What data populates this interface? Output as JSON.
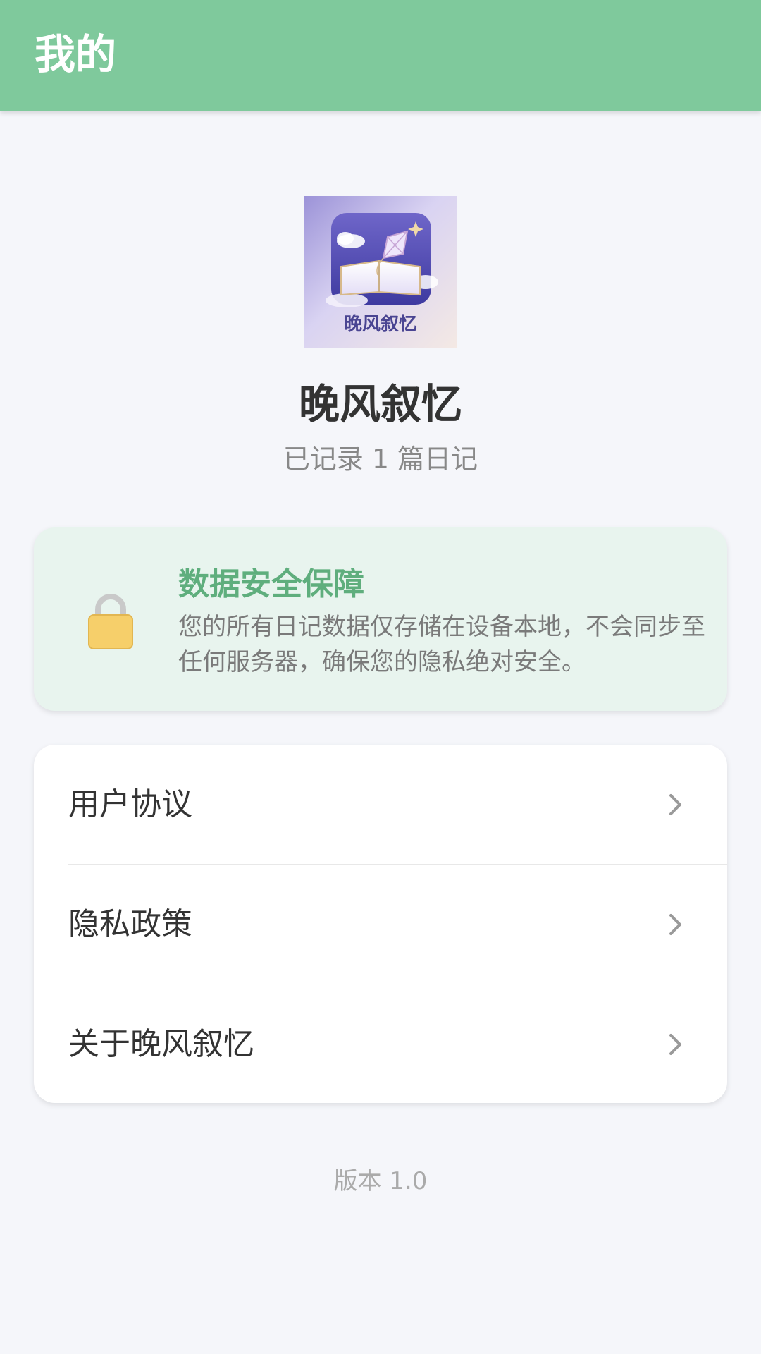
{
  "header": {
    "title": "我的"
  },
  "profile": {
    "logo_text": "晚风叙忆",
    "app_name": "晚风叙忆",
    "diary_count": "已记录 1 篇日记"
  },
  "security": {
    "icon": "lock-icon",
    "title": "数据安全保障",
    "description": "您的所有日记数据仅存储在设备本地，不会同步至任何服务器，确保您的隐私绝对安全。"
  },
  "menu": {
    "items": [
      {
        "label": "用户协议",
        "icon": "chevron-right-icon"
      },
      {
        "label": "隐私政策",
        "icon": "chevron-right-icon"
      },
      {
        "label": "关于晚风叙忆",
        "icon": "chevron-right-icon"
      }
    ]
  },
  "footer": {
    "version": "版本 1.0"
  },
  "colors": {
    "header": "#7fc99c",
    "accent": "#5fae7d",
    "background": "#f5f6fa",
    "security_card": "#e8f4ee"
  }
}
